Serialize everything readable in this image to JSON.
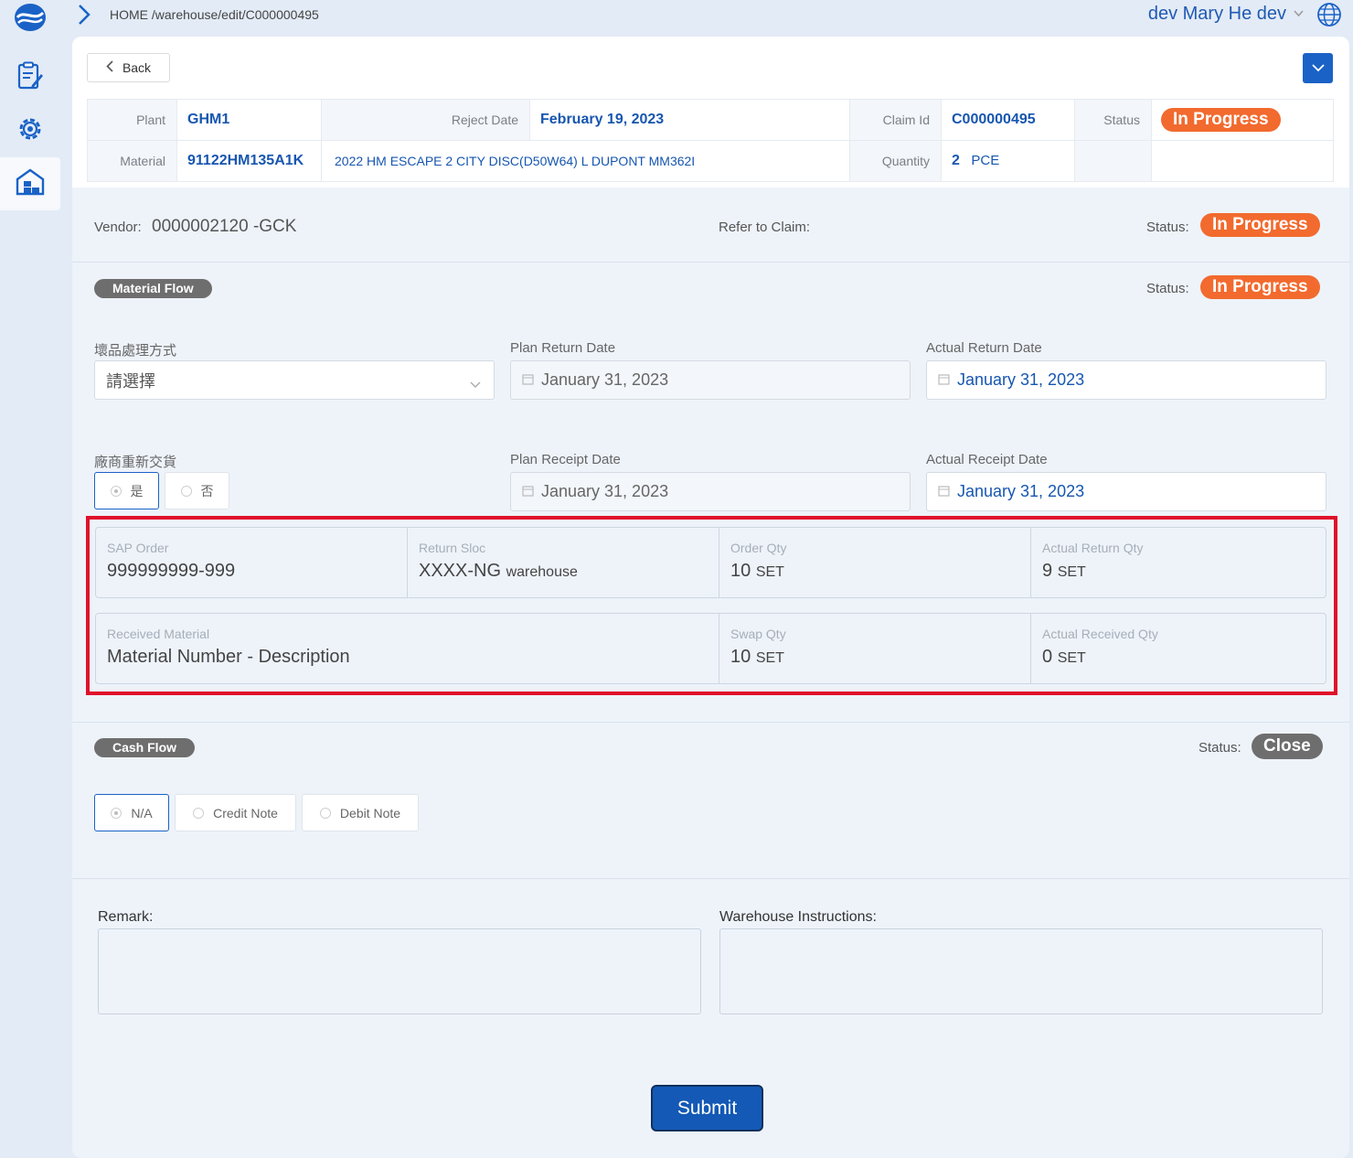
{
  "colors": {
    "accent": "#1a62c6",
    "status_progress": "#f26a2e",
    "status_close": "#6e6e6e",
    "highlight": "#e0102b"
  },
  "sidebar": {
    "logo": "app-logo-icon",
    "items": [
      {
        "icon": "clipboard-edit-icon"
      },
      {
        "icon": "gear-icon"
      },
      {
        "icon": "warehouse-icon",
        "active": true
      }
    ]
  },
  "topbar": {
    "breadcrumb": "HOME /warehouse/edit/C000000495",
    "user": "dev Mary He dev",
    "language_icon": "globe-icon"
  },
  "header": {
    "back_label": "Back",
    "collapse_icon": "chevron-down-icon"
  },
  "summary": {
    "plant_label": "Plant",
    "plant": "GHM1",
    "reject_date_label": "Reject Date",
    "reject_date": "February 19, 2023",
    "claim_id_label": "Claim Id",
    "claim_id": "C000000495",
    "status_label": "Status",
    "status": "In Progress",
    "material_label": "Material",
    "material": "91122HM135A1K",
    "material_desc": "2022 HM ESCAPE 2 CITY DISC(D50W64) L DUPONT MM362I",
    "quantity_label": "Quantity",
    "quantity": "2",
    "quantity_unit": "PCE"
  },
  "vendor": {
    "label": "Vendor:",
    "value": "0000002120 -GCK",
    "refer_label": "Refer to Claim:",
    "status_label": "Status:",
    "status": "In Progress"
  },
  "material_flow": {
    "title": "Material Flow",
    "status_label": "Status:",
    "status": "In Progress",
    "disposal_label": "壞品處理方式",
    "disposal_placeholder": "請選擇",
    "plan_return_label": "Plan Return Date",
    "plan_return": "January 31, 2023",
    "actual_return_label": "Actual Return Date",
    "actual_return": "January 31, 2023",
    "reship_label": "廠商重新交貨",
    "reship_yes": "是",
    "reship_no": "否",
    "plan_receipt_label": "Plan Receipt Date",
    "plan_receipt": "January 31, 2023",
    "actual_receipt_label": "Actual Receipt Date",
    "actual_receipt": "January 31, 2023"
  },
  "details": {
    "sap_order_label": "SAP Order",
    "sap_order": "999999999-999",
    "return_sloc_label": "Return Sloc",
    "return_sloc": "XXXX-NG",
    "return_sloc_suffix": "warehouse",
    "order_qty_label": "Order Qty",
    "order_qty": "10",
    "order_qty_unit": "SET",
    "actual_return_qty_label": "Actual Return Qty",
    "actual_return_qty": "9",
    "actual_return_qty_unit": "SET",
    "received_material_label": "Received Material",
    "received_material": "Material Number - Description",
    "swap_qty_label": "Swap Qty",
    "swap_qty": "10",
    "swap_qty_unit": "SET",
    "actual_received_qty_label": "Actual Received Qty",
    "actual_received_qty": "0",
    "actual_received_qty_unit": "SET"
  },
  "cash_flow": {
    "title": "Cash Flow",
    "status_label": "Status:",
    "status": "Close",
    "options": [
      "N/A",
      "Credit Note",
      "Debit Note"
    ]
  },
  "notes": {
    "remark_label": "Remark:",
    "instructions_label": "Warehouse Instructions:"
  },
  "submit_label": "Submit"
}
